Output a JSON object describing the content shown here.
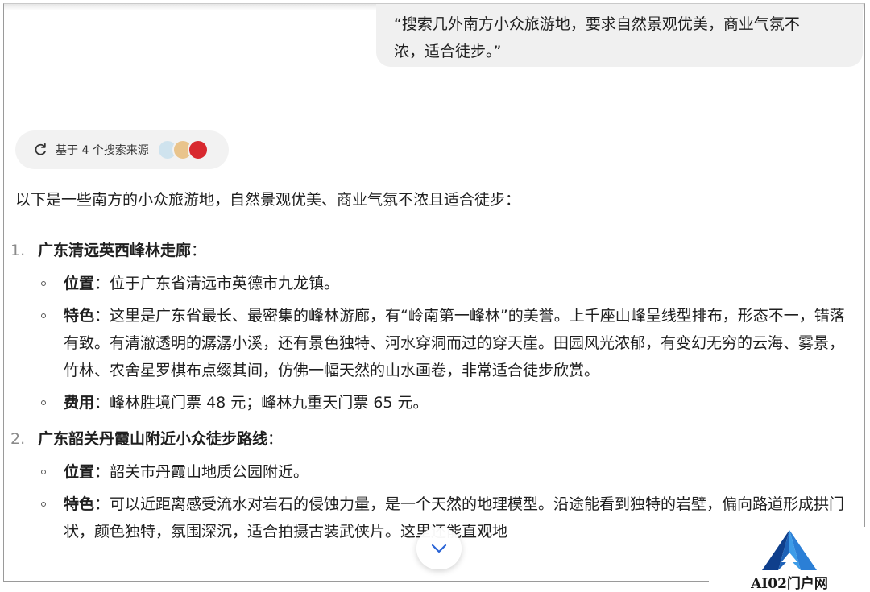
{
  "user_message": {
    "line1": "“搜索几外南方小众旅游地，要求自然景观优美，商业气氛不",
    "line2": "浓，适合徒步。”"
  },
  "sources": {
    "label": "基于 4 个搜索来源",
    "favicon_colors": [
      "#cfe3ee",
      "#e9c48c",
      "#d8292f"
    ]
  },
  "answer": {
    "intro": "以下是一些南方的小众旅游地，自然景观优美、商业气氛不浓且适合徒步：",
    "items": [
      {
        "number": "1.",
        "title": "广东清远英西峰林走廊",
        "colon": "：",
        "details": [
          {
            "label": "位置",
            "sep": "：",
            "text": "位于广东省清远市英德市九龙镇。"
          },
          {
            "label": "特色",
            "sep": "：",
            "text": "这里是广东省最长、最密集的峰林游廊，有“岭南第一峰林”的美誉。上千座山峰呈线型排布，形态不一，错落有致。有清澈透明的潺潺小溪，还有景色独特、河水穿洞而过的穿天崖。田园风光浓郁，有变幻无穷的云海、雾景，竹林、农舍星罗棋布点缀其间，仿佛一幅天然的山水画卷，非常适合徒步欣赏。"
          },
          {
            "label": "费用",
            "sep": "：",
            "text": "峰林胜境门票 48 元；峰林九重天门票 65 元。"
          }
        ]
      },
      {
        "number": "2.",
        "title": "广东韶关丹霞山附近小众徒步路线",
        "colon": "：",
        "details": [
          {
            "label": "位置",
            "sep": "：",
            "text": "韶关市丹霞山地质公园附近。"
          },
          {
            "label": "特色",
            "sep": "：",
            "text": "可以近距离感受流水对岩石的侵蚀力量，是一个天然的地理模型。沿途能看到独特的岩壁，偏向路道形成拱门状，颜色独特，氛围深沉，适合拍摄古装武侠片。这里还能直观地"
          }
        ]
      }
    ]
  },
  "scroll_button": {
    "icon": "chevron-down-icon"
  },
  "watermark": {
    "text": "AI02门户网"
  }
}
